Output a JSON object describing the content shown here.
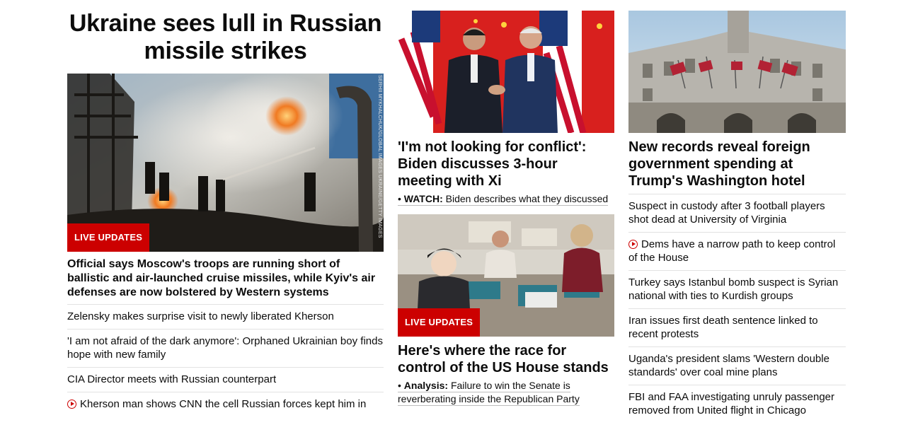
{
  "col1": {
    "title": "Ukraine sees lull in Russian missile strikes",
    "badge": "LIVE UPDATES",
    "credit": "SERHII MYKHALCHUK/GLOBAL IMAGES UKRAINE/GETTY IMAGES",
    "lead": "Official says Moscow's troops are running short of ballistic and air-launched cruise missiles, while Kyiv's air defenses are now bolstered by Western systems",
    "items": [
      {
        "text": "Zelensky makes surprise visit to newly liberated Kherson",
        "video": false
      },
      {
        "text": "'I am not afraid of the dark anymore': Orphaned Ukrainian boy finds hope with new family",
        "video": false
      },
      {
        "text": "CIA Director meets with Russian counterpart",
        "video": false
      },
      {
        "text": "Kherson man shows CNN the cell Russian forces kept him in",
        "video": true
      }
    ]
  },
  "col2": {
    "story1": {
      "headline": "'I'm not looking for conflict': Biden discusses 3-hour meeting with Xi",
      "sub_label": "WATCH:",
      "sub_text": "Biden describes what they discussed"
    },
    "story2": {
      "badge": "LIVE UPDATES",
      "headline": "Here's where the race for control of the US House stands",
      "sub_label": "Analysis:",
      "sub_text": "Failure to win the Senate is reverberating inside the Republican Party"
    }
  },
  "col3": {
    "headline": "New records reveal foreign government spending at Trump's Washington hotel",
    "items": [
      {
        "text": "Suspect in custody after 3 football players shot dead at University of Virginia",
        "video": false
      },
      {
        "text": "Dems have a narrow path to keep control of the House",
        "video": true
      },
      {
        "text": "Turkey says Istanbul bomb suspect is Syrian national with ties to Kurdish groups",
        "video": false
      },
      {
        "text": "Iran issues first death sentence linked to recent protests",
        "video": false
      },
      {
        "text": "Uganda's president slams 'Western double standards' over coal mine plans",
        "video": false
      },
      {
        "text": "FBI and FAA investigating unruly passenger removed from United flight in Chicago",
        "video": false
      }
    ]
  },
  "colors": {
    "accent": "#cc0000",
    "text": "#0c0c0c",
    "divider": "#e2e2e2"
  },
  "icons": {
    "video": "play-circle-icon"
  }
}
